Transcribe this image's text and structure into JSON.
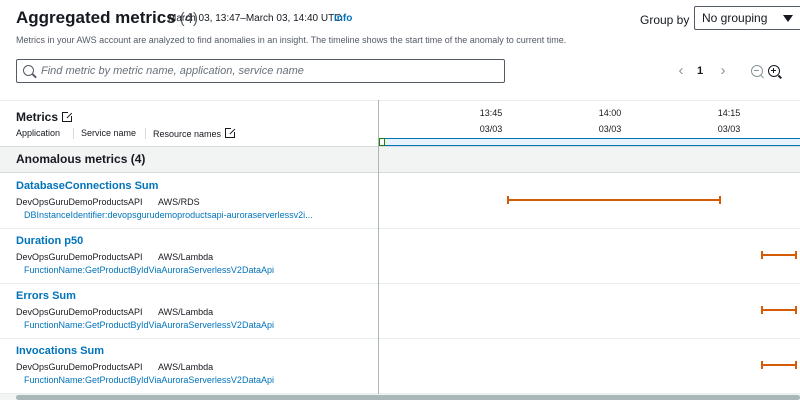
{
  "header": {
    "title": "Aggregated metrics",
    "count": "(4)",
    "time_range": "March 03, 13:47–March 03, 14:40 UTC",
    "info_label": "Info",
    "group_by_label": "Group by",
    "group_by_value": "No grouping"
  },
  "description": "Metrics in your AWS account are analyzed to find anomalies in an insight. The timeline shows the start time of the anomaly to current time.",
  "search": {
    "placeholder": "Find metric by metric name, application, service name",
    "value": ""
  },
  "pagination": {
    "current_page": "1",
    "prev_icon": "chevron-left-icon",
    "next_icon": "chevron-right-icon"
  },
  "icons": {
    "search": "search-icon",
    "zoom_out": "zoom-out-icon",
    "zoom_in": "zoom-in-icon",
    "external": "external-link-icon",
    "dropdown": "caret-down-icon"
  },
  "columns": {
    "metrics": "Metrics",
    "application": "Application",
    "service_name": "Service name",
    "resource_names": "Resource names"
  },
  "timeline": {
    "ticks": [
      {
        "time": "13:45",
        "date": "03/03"
      },
      {
        "time": "14:00",
        "date": "03/03"
      },
      {
        "time": "14:15",
        "date": "03/03"
      }
    ]
  },
  "group": {
    "title": "Anomalous metrics (4)"
  },
  "colors": {
    "link": "#0073bb",
    "anomaly": "#d45b07",
    "selection": "#0073bb"
  },
  "metrics": [
    {
      "name": "DatabaseConnections Sum",
      "application": "DevOpsGuruDemoProductsAPI",
      "service": "AWS/RDS",
      "resource": "DBInstanceIdentifier:devopsgurudemoproductsapi-auroraserverlessv2i...",
      "span_start": "13:47",
      "span_end": "14:14"
    },
    {
      "name": "Duration p50",
      "application": "DevOpsGuruDemoProductsAPI",
      "service": "AWS/Lambda",
      "resource": "FunctionName:GetProductByIdViaAuroraServerlessV2DataApi",
      "span_start": "14:19",
      "span_end": "14:26"
    },
    {
      "name": "Errors Sum",
      "application": "DevOpsGuruDemoProductsAPI",
      "service": "AWS/Lambda",
      "resource": "FunctionName:GetProductByIdViaAuroraServerlessV2DataApi",
      "span_start": "14:19",
      "span_end": "14:26"
    },
    {
      "name": "Invocations Sum",
      "application": "DevOpsGuruDemoProductsAPI",
      "service": "AWS/Lambda",
      "resource": "FunctionName:GetProductByIdViaAuroraServerlessV2DataApi",
      "span_start": "14:19",
      "span_end": "14:26"
    }
  ]
}
